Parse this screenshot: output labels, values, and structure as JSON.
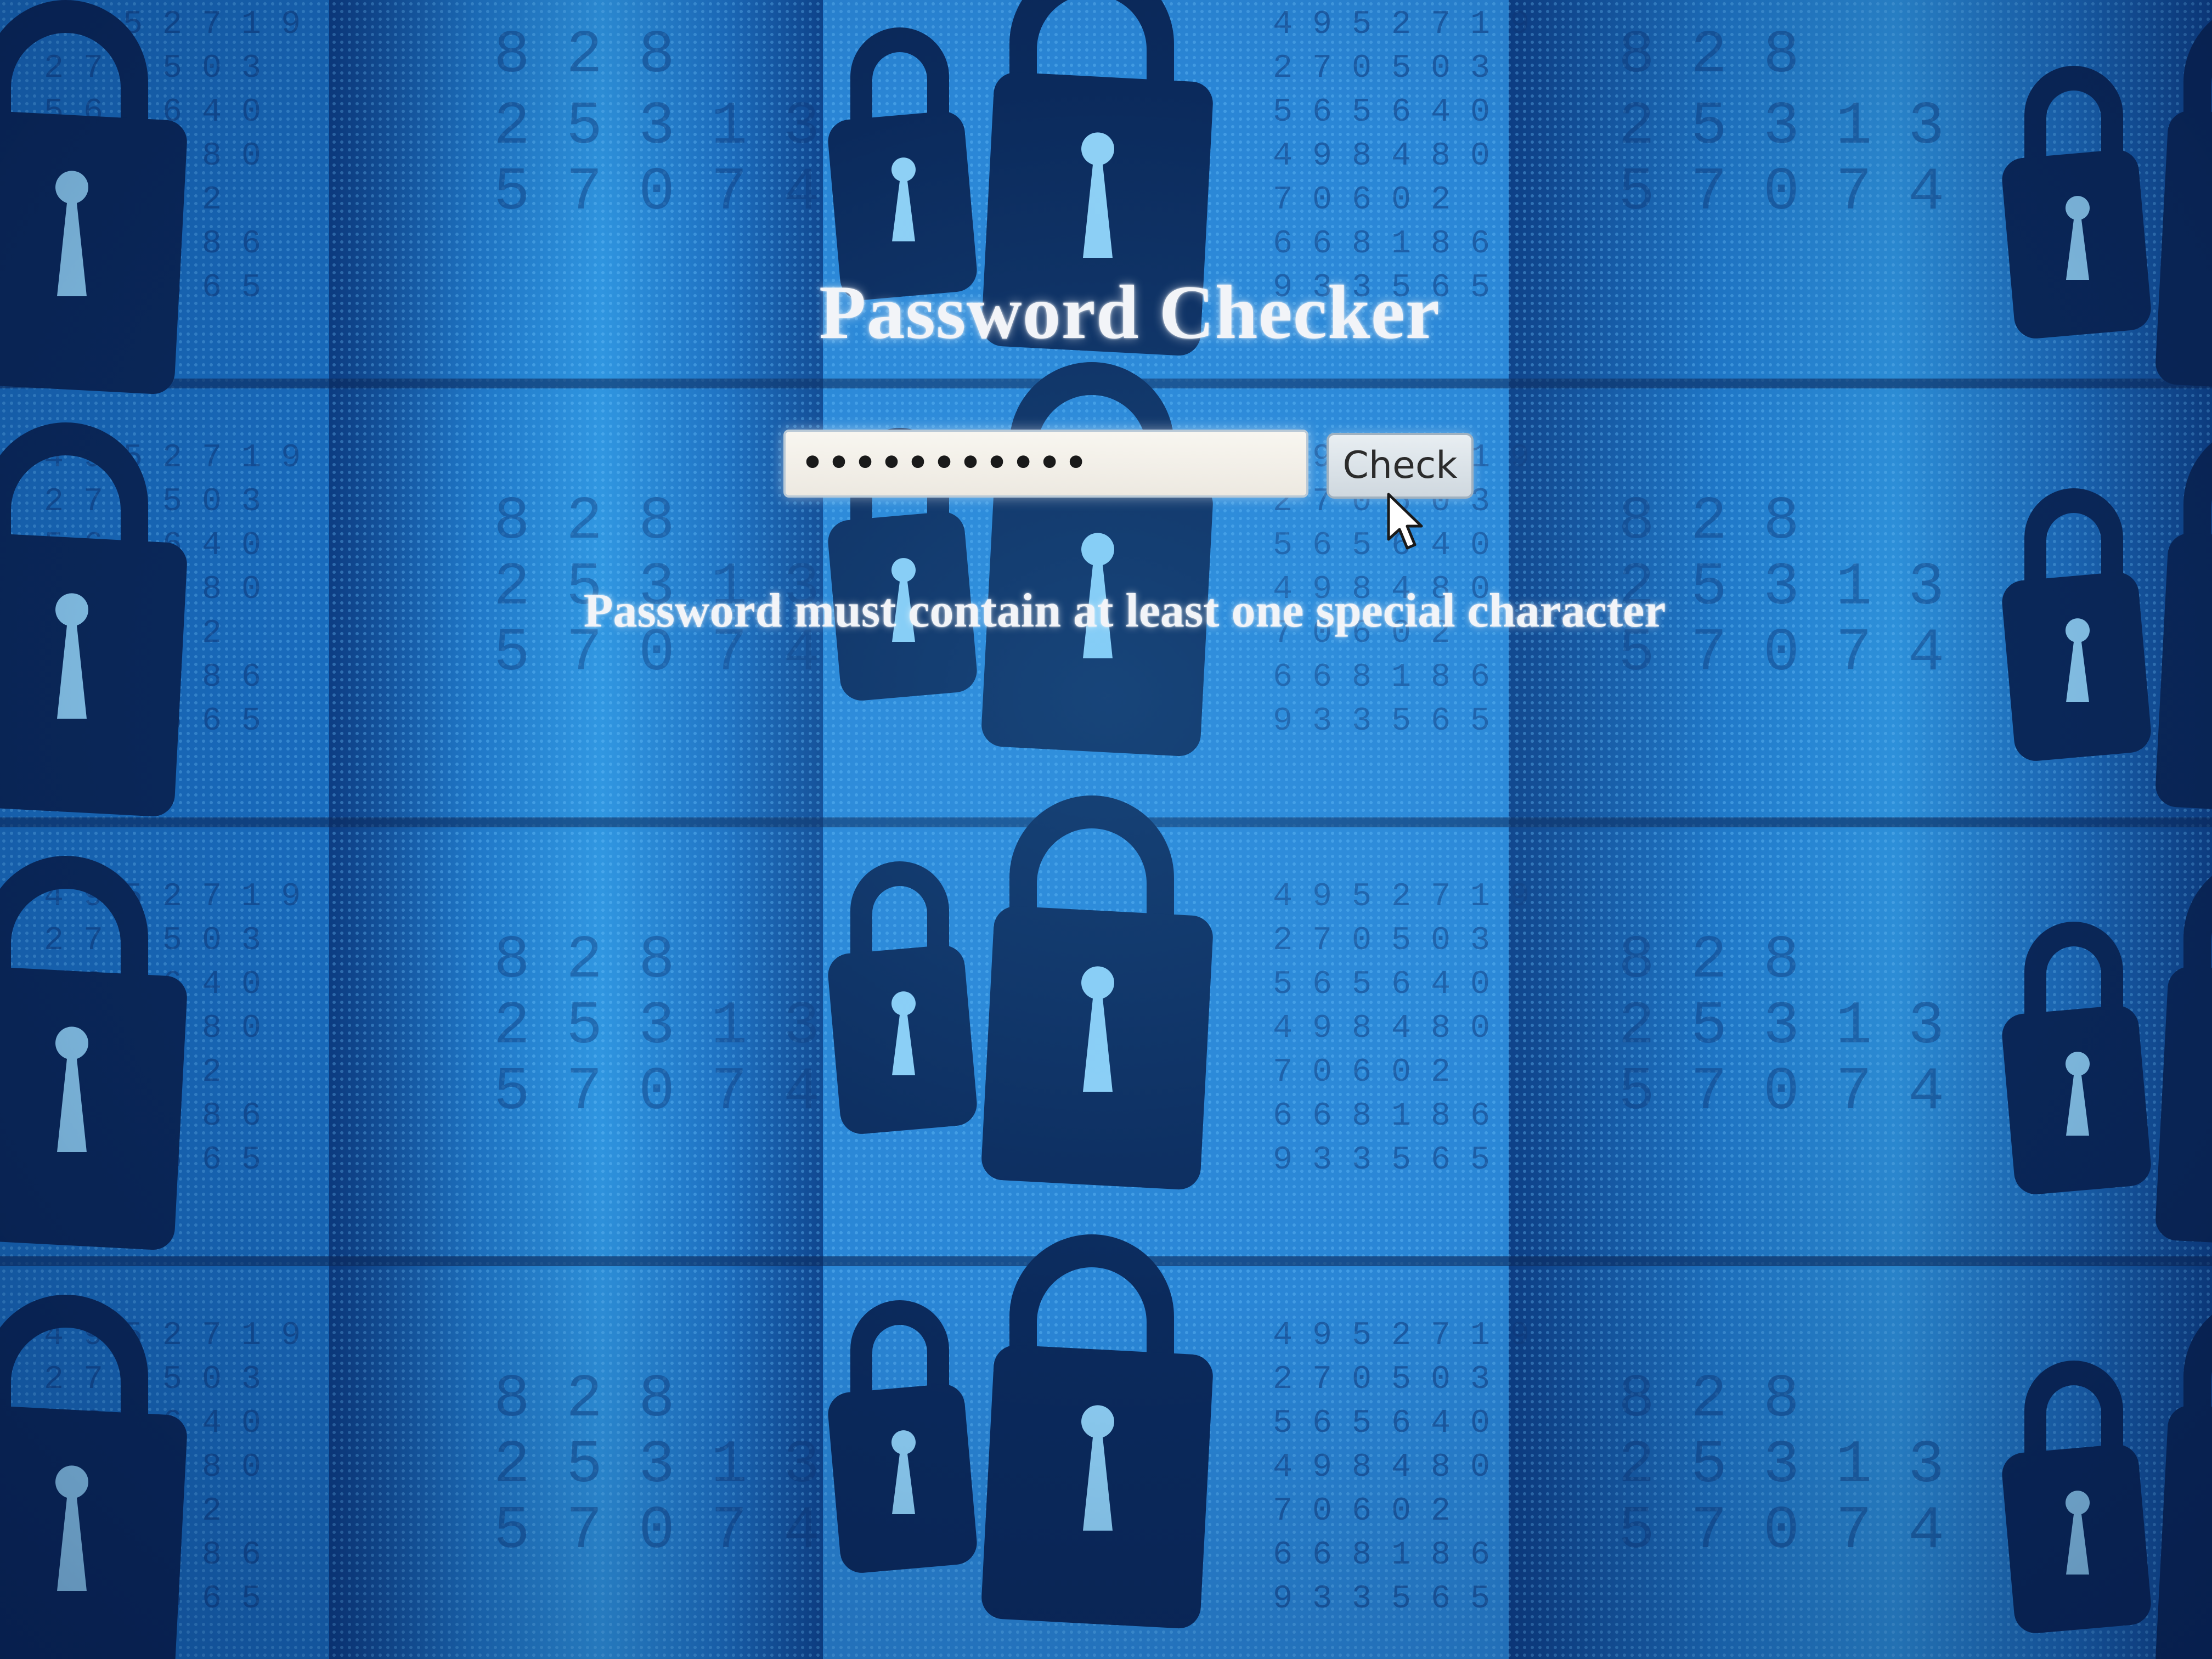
{
  "page": {
    "title": "Password Checker",
    "background_icon": "padlock-icon"
  },
  "form": {
    "password_value": "•••••••••••",
    "check_label": "Check"
  },
  "result": {
    "message": "Password must contain at least one special character"
  },
  "colors": {
    "background": "#1a67b8",
    "padlock": "#0b2a5c",
    "text": "#f2f4f8",
    "input_bg": "#f8f6f0",
    "button_bg": "#dce3e8"
  }
}
